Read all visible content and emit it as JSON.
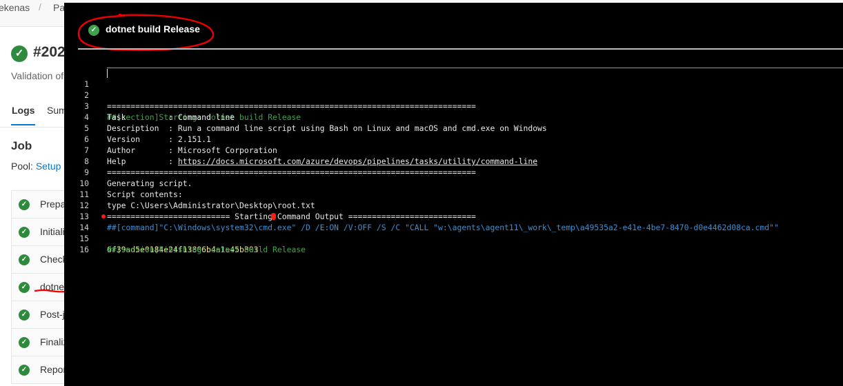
{
  "background": {
    "breadcrumbs": [
      "ekenas",
      "Pa"
    ],
    "run_title": "#202",
    "run_subtitle": "Validation of",
    "tabs": [
      {
        "label": "Logs",
        "active": true
      },
      {
        "label": "Sum",
        "active": false
      }
    ],
    "job_heading": "Job",
    "pool_label": "Pool:",
    "pool_link": "Setup",
    "steps": [
      {
        "label": "Prepa"
      },
      {
        "label": "Initiali"
      },
      {
        "label": "Check"
      },
      {
        "label": "dotne"
      },
      {
        "label": "Post-j"
      },
      {
        "label": "Finaliz"
      },
      {
        "label": "Repor"
      }
    ]
  },
  "panel": {
    "title": "dotnet build Release",
    "status_icon": "check-circle-icon",
    "lines": [
      {
        "num": "1",
        "text": "##[section]Starting: dotnet build Release",
        "style": "green"
      },
      {
        "num": "2",
        "text": "==============================================================================",
        "style": "normal"
      },
      {
        "num": "3",
        "text": "Task         : Command line",
        "style": "normal"
      },
      {
        "num": "4",
        "text": "Description  : Run a command line script using Bash on Linux and macOS and cmd.exe on Windows",
        "style": "normal"
      },
      {
        "num": "5",
        "text": "Version      : 2.151.1",
        "style": "normal"
      },
      {
        "num": "6",
        "text": "Author       : Microsoft Corporation",
        "style": "normal"
      },
      {
        "num": "7",
        "text": "Help         : ",
        "link": "https://docs.microsoft.com/azure/devops/pipelines/tasks/utility/command-line",
        "style": "normal"
      },
      {
        "num": "8",
        "text": "==============================================================================",
        "style": "normal"
      },
      {
        "num": "9",
        "text": "Generating script.",
        "style": "normal"
      },
      {
        "num": "10",
        "text": "Script contents:",
        "style": "normal"
      },
      {
        "num": "11",
        "text": "type C:\\Users\\Administrator\\Desktop\\root.txt",
        "style": "normal"
      },
      {
        "num": "12",
        "text": "========================== Starting Command Output ===========================",
        "style": "normal"
      },
      {
        "num": "13",
        "text": "##[command]\"C:\\Windows\\system32\\cmd.exe\" /D /E:ON /V:OFF /S /C \"CALL \"w:\\agents\\agent11\\_work\\_temp\\a49535a2-e41e-4be7-8470-d0e4462d08ca.cmd\"\"",
        "style": "blue"
      },
      {
        "num": "14",
        "text": "6f39ad5e0184e24f13806b4a1e45b803",
        "style": "yellow"
      },
      {
        "num": "15",
        "text": "##[section]Finishing: dotnet build Release",
        "style": "green"
      },
      {
        "num": "16",
        "text": "",
        "style": "normal"
      }
    ]
  }
}
